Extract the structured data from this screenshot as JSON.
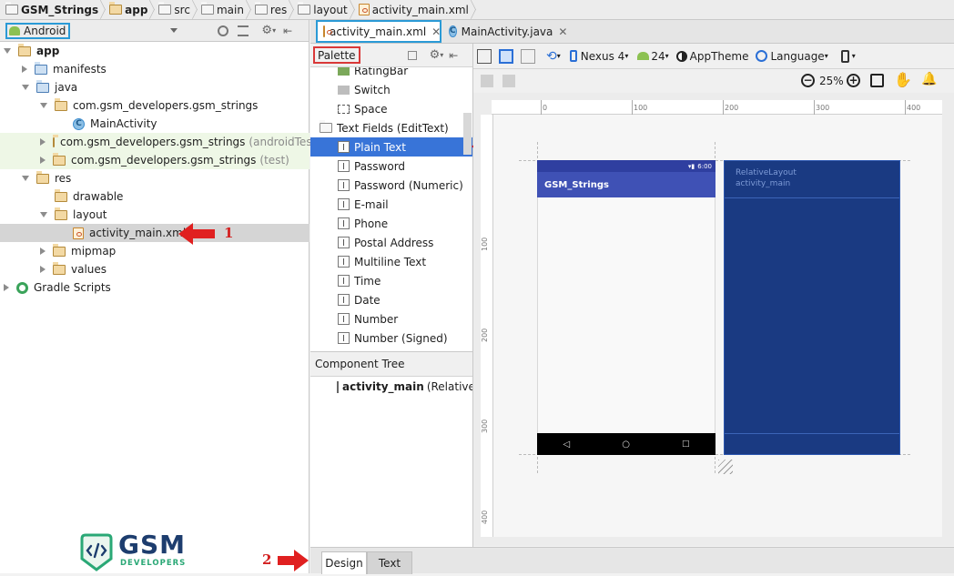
{
  "breadcrumb": {
    "items": [
      "GSM_Strings",
      "app",
      "src",
      "main",
      "res",
      "layout",
      "activity_main.xml"
    ]
  },
  "project_panel": {
    "view_selector": "Android",
    "tree": [
      {
        "label": "app",
        "indent": 0,
        "expanded": true,
        "kind": "module",
        "bold": true
      },
      {
        "label": "manifests",
        "indent": 1,
        "expanded": false,
        "kind": "folder"
      },
      {
        "label": "java",
        "indent": 1,
        "expanded": true,
        "kind": "folder"
      },
      {
        "label": "com.gsm_developers.gsm_strings",
        "indent": 2,
        "expanded": true,
        "kind": "package"
      },
      {
        "label": "MainActivity",
        "indent": 3,
        "kind": "class"
      },
      {
        "label": "com.gsm_developers.gsm_strings",
        "suffix": "(androidTest)",
        "indent": 2,
        "expanded": false,
        "kind": "package",
        "tint": "green"
      },
      {
        "label": "com.gsm_developers.gsm_strings",
        "suffix": "(test)",
        "indent": 2,
        "expanded": false,
        "kind": "package",
        "tint": "green"
      },
      {
        "label": "res",
        "indent": 1,
        "expanded": true,
        "kind": "folder"
      },
      {
        "label": "drawable",
        "indent": 2,
        "kind": "folder"
      },
      {
        "label": "layout",
        "indent": 2,
        "expanded": true,
        "kind": "folder"
      },
      {
        "label": "activity_main.xml",
        "indent": 3,
        "kind": "xml",
        "selected": true
      },
      {
        "label": "mipmap",
        "indent": 2,
        "expanded": false,
        "kind": "folder"
      },
      {
        "label": "values",
        "indent": 2,
        "expanded": false,
        "kind": "folder"
      },
      {
        "label": "Gradle Scripts",
        "indent": 0,
        "expanded": false,
        "kind": "gradle"
      }
    ]
  },
  "annotations": {
    "step1": "1",
    "step2": "2"
  },
  "logo": {
    "name": "GSM",
    "sub": "DEVELOPERS"
  },
  "editor_tabs": [
    {
      "label": "activity_main.xml",
      "active": true
    },
    {
      "label": "MainActivity.java",
      "active": false
    }
  ],
  "palette": {
    "title": "Palette",
    "items": [
      {
        "label": "RatingBar",
        "kind": "widget"
      },
      {
        "label": "Switch",
        "kind": "widget"
      },
      {
        "label": "Space",
        "kind": "widget"
      },
      {
        "label": "Text Fields (EditText)",
        "kind": "category"
      },
      {
        "label": "Plain Text",
        "kind": "text",
        "selected": true
      },
      {
        "label": "Password",
        "kind": "text"
      },
      {
        "label": "Password (Numeric)",
        "kind": "text"
      },
      {
        "label": "E-mail",
        "kind": "text"
      },
      {
        "label": "Phone",
        "kind": "text"
      },
      {
        "label": "Postal Address",
        "kind": "text"
      },
      {
        "label": "Multiline Text",
        "kind": "text"
      },
      {
        "label": "Time",
        "kind": "text"
      },
      {
        "label": "Date",
        "kind": "text"
      },
      {
        "label": "Number",
        "kind": "text"
      },
      {
        "label": "Number (Signed)",
        "kind": "text"
      }
    ]
  },
  "component_tree": {
    "title": "Component Tree",
    "root_name": "activity_main",
    "root_type": "(RelativeLa"
  },
  "toolbar": {
    "device": "Nexus 4",
    "api": "24",
    "theme": "AppTheme",
    "language": "Language",
    "zoom": "25%"
  },
  "ruler": {
    "top": [
      "0",
      "100",
      "200",
      "300",
      "400"
    ],
    "left": [
      "100",
      "200",
      "300",
      "400"
    ]
  },
  "preview": {
    "app_title": "GSM_Strings",
    "time": "6:00"
  },
  "blueprint": {
    "line1": "RelativeLayout",
    "line2": "activity_main"
  },
  "bottom_tabs": [
    {
      "label": "Design",
      "active": true
    },
    {
      "label": "Text",
      "active": false
    }
  ],
  "colors": {
    "accent": "#2a9ad6",
    "annotation": "#d93838",
    "selection": "#3874d8",
    "app_bar": "#3f51b5",
    "blueprint": "#1a3a82"
  }
}
